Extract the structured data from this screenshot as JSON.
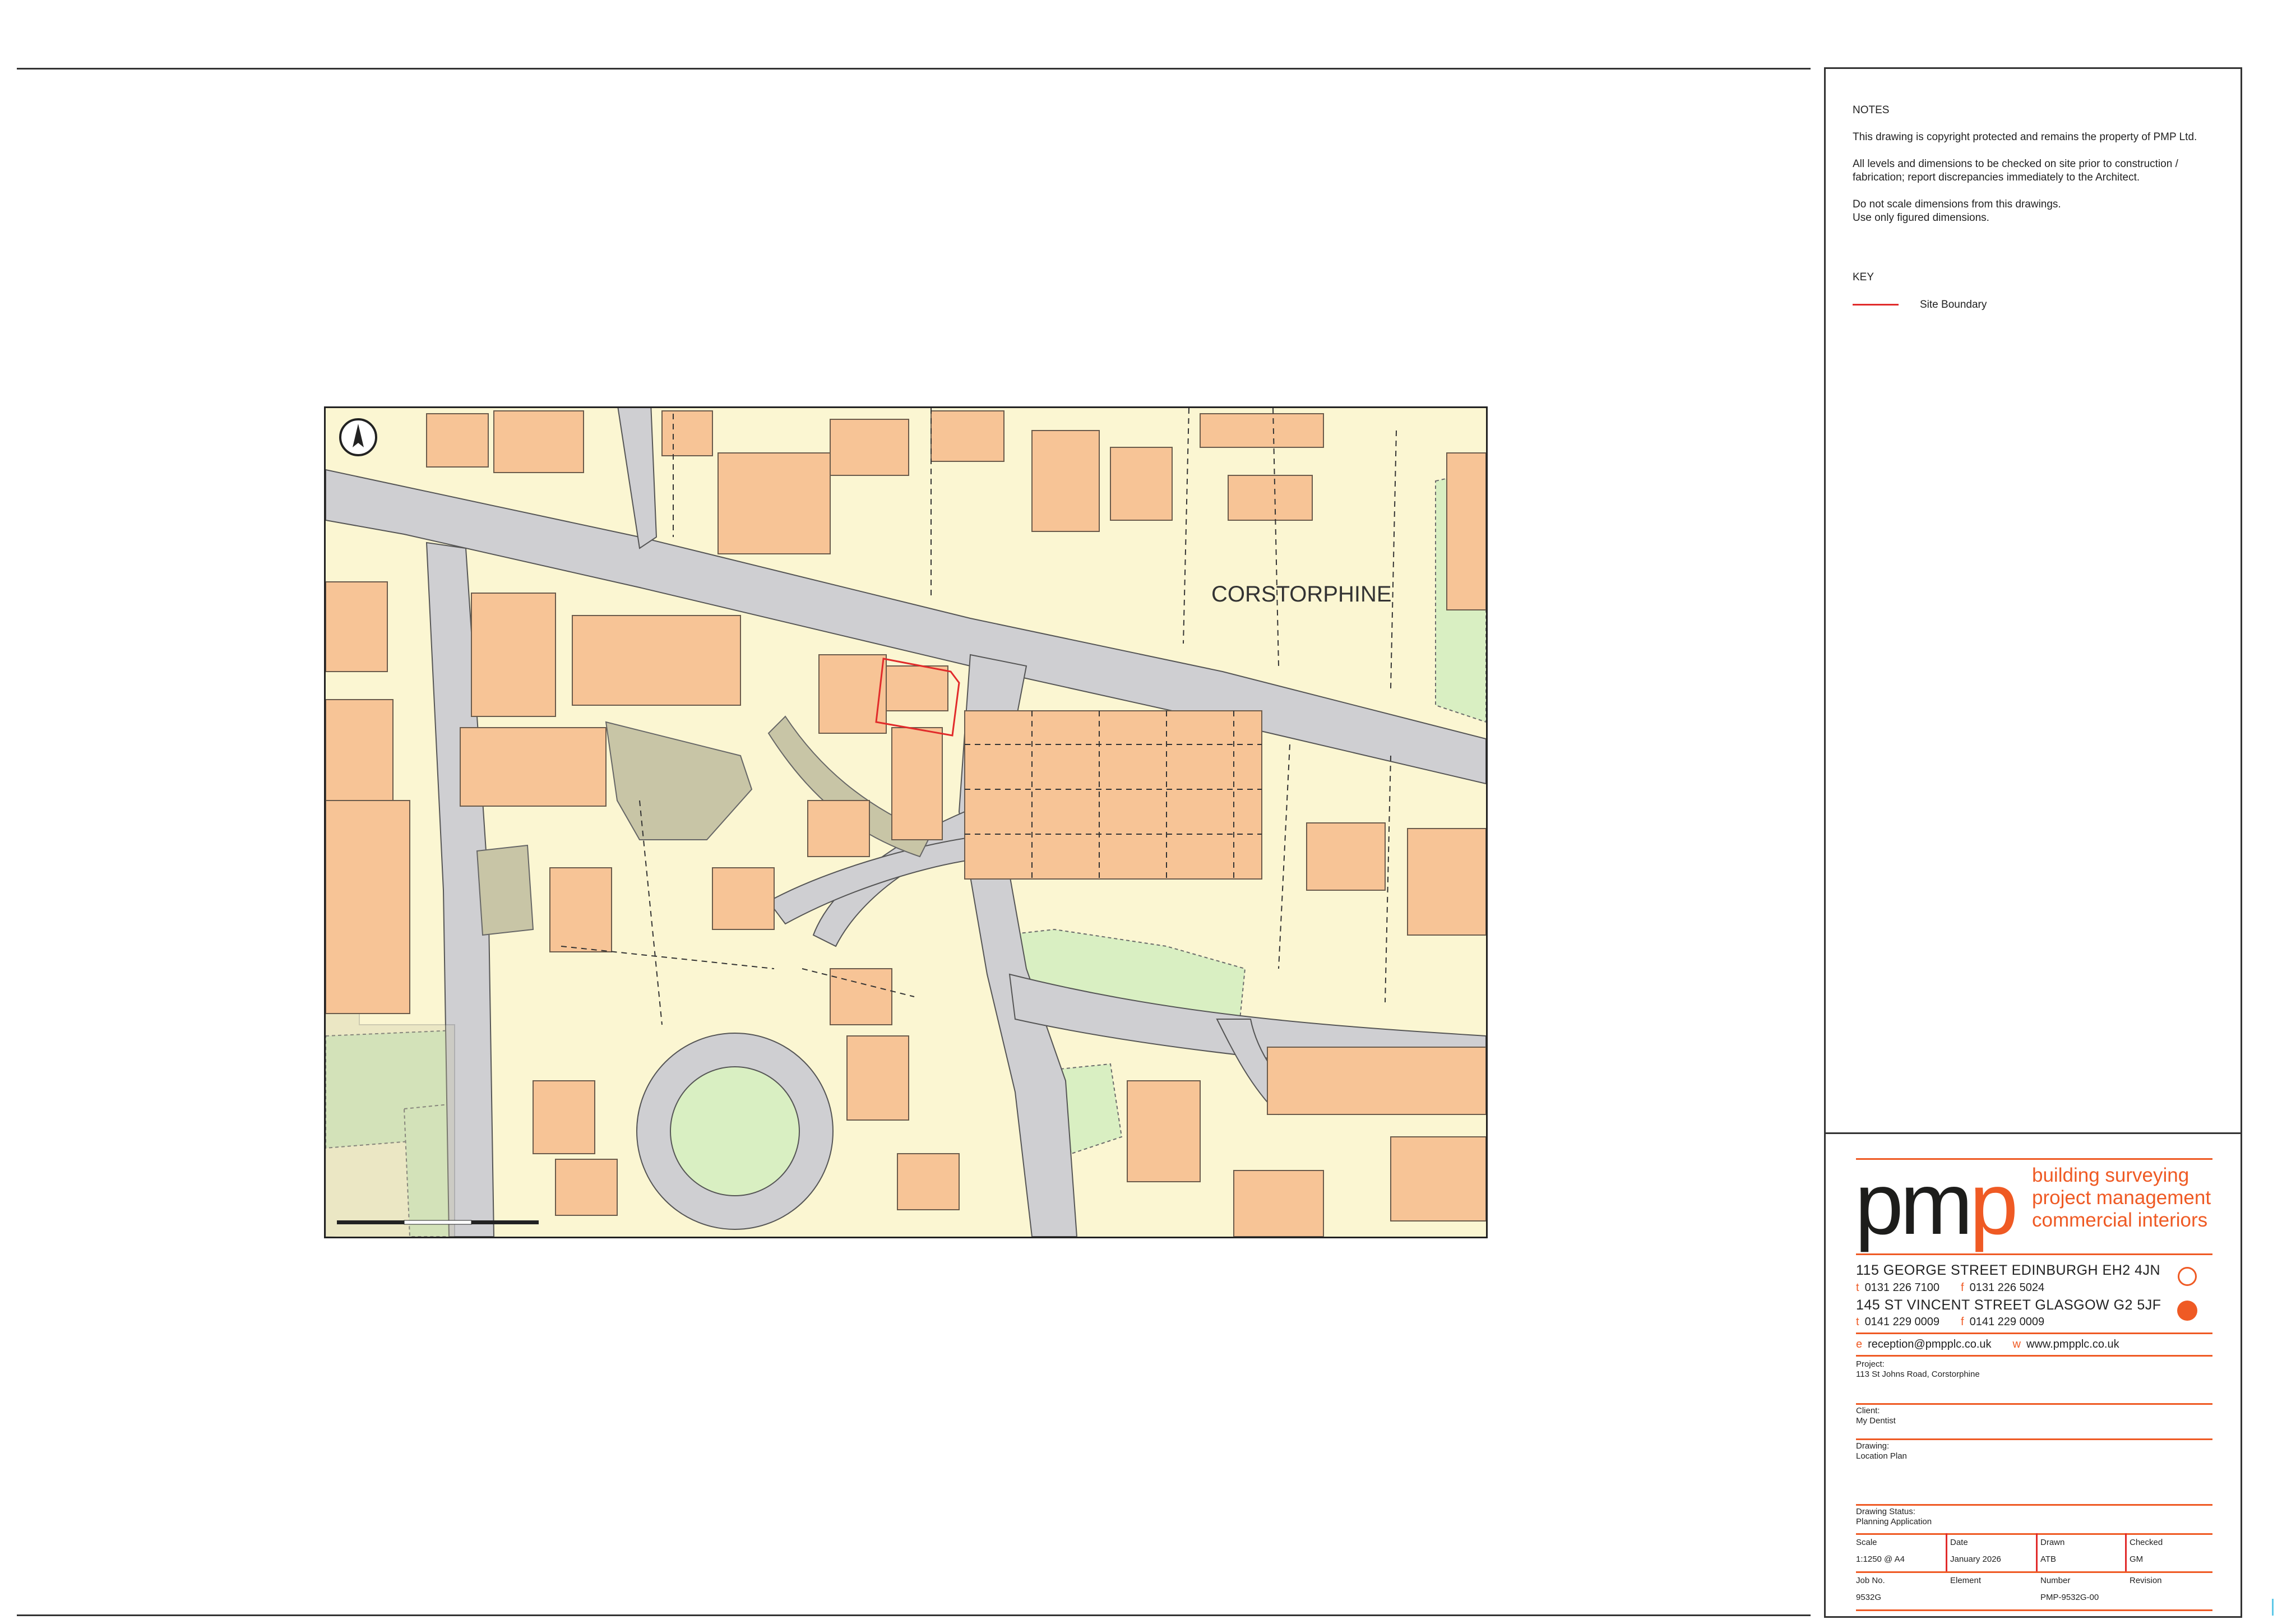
{
  "notes": {
    "heading": "NOTES",
    "line1": "This drawing is copyright protected and remains the property of PMP Ltd.",
    "line2": "All levels and dimensions to be checked on site prior to construction / fabrication; report discrepancies immediately to the Architect.",
    "line3a": "Do not scale dimensions from this drawings.",
    "line3b": "Use only figured dimensions."
  },
  "key": {
    "heading": "KEY",
    "site_boundary": "Site Boundary",
    "boundary_color": "#e12b2b"
  },
  "map": {
    "area_label": "CORSTORPHINE"
  },
  "company": {
    "logo_a": "pm",
    "logo_b": "p",
    "tag1": "building surveying",
    "tag2": "project management",
    "tag3": "commercial interiors",
    "office1": "115 GEORGE STREET  EDINBURGH  EH2 4JN",
    "office1_t_label": "t",
    "office1_t": "0131 226 7100",
    "office1_f_label": "f",
    "office1_f": "0131 226 5024",
    "office2": "145  ST VINCENT STREET  GLASGOW  G2 5JF",
    "office2_t_label": "t",
    "office2_t": "0141 229 0009",
    "office2_f_label": "f",
    "office2_f": "0141 229 0009",
    "email_label": "e",
    "email": "reception@pmpplc.co.uk",
    "web_label": "w",
    "web": "www.pmpplc.co.uk",
    "accent": "#ef5a24"
  },
  "title_block": {
    "project_label": "Project:",
    "project": "113 St Johns Road, Corstorphine",
    "client_label": "Client:",
    "client": "My Dentist",
    "drawing_label": "Drawing:",
    "drawing": "Location Plan",
    "status_label": "Drawing Status:",
    "status": "Planning Application",
    "scale_label": "Scale",
    "scale": "1:1250 @ A4",
    "date_label": "Date",
    "date": "January 2026",
    "drawn_label": "Drawn",
    "drawn": "ATB",
    "checked_label": "Checked",
    "checked": "GM",
    "job_label": "Job No.",
    "job": "9532G",
    "element_label": "Element",
    "element": "",
    "number_label": "Number",
    "number": "PMP-9532G-00",
    "revision_label": "Revision",
    "revision": ""
  }
}
